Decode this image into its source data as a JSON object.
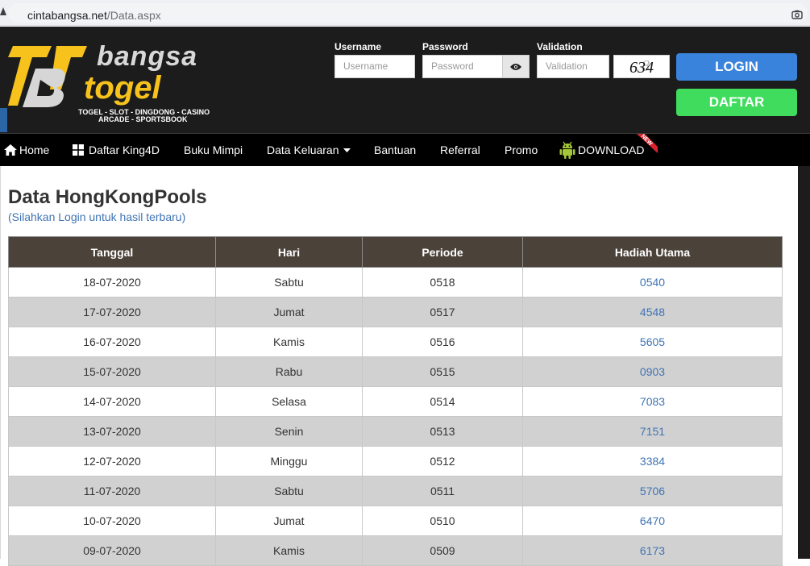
{
  "browser": {
    "url_domain": "cintabangsa.net",
    "url_path": "/Data.aspx"
  },
  "logo": {
    "word1": "bangsa",
    "word2": "togel",
    "tagline1": "TOGEL - SLOT - DINGDONG - CASINO",
    "tagline2": "ARCADE - SPORTSBOOK"
  },
  "login_form": {
    "username_label": "Username",
    "username_placeholder": "Username",
    "password_label": "Password",
    "password_placeholder": "Password",
    "validation_label": "Validation",
    "validation_placeholder": "Validation",
    "captcha_text": "634",
    "captcha_noise": "8",
    "login_button": "LOGIN",
    "daftar_button": "DAFTAR"
  },
  "nav": {
    "items": [
      {
        "label": "Home",
        "icon": "home-icon"
      },
      {
        "label": "Daftar King4D",
        "icon": "windows-icon"
      },
      {
        "label": "Buku Mimpi"
      },
      {
        "label": "Data Keluaran",
        "icon": "caret-down-icon"
      },
      {
        "label": "Bantuan"
      },
      {
        "label": "Referral"
      },
      {
        "label": "Promo"
      },
      {
        "label": "DOWNLOAD",
        "icon": "android-icon"
      }
    ],
    "new_badge": "NEW"
  },
  "page": {
    "title": "Data HongKongPools",
    "subtitle": "(Silahkan Login untuk hasil terbaru)"
  },
  "table": {
    "headers": [
      "Tanggal",
      "Hari",
      "Periode",
      "Hadiah Utama"
    ],
    "rows": [
      [
        "18-07-2020",
        "Sabtu",
        "0518",
        "0540"
      ],
      [
        "17-07-2020",
        "Jumat",
        "0517",
        "4548"
      ],
      [
        "16-07-2020",
        "Kamis",
        "0516",
        "5605"
      ],
      [
        "15-07-2020",
        "Rabu",
        "0515",
        "0903"
      ],
      [
        "14-07-2020",
        "Selasa",
        "0514",
        "7083"
      ],
      [
        "13-07-2020",
        "Senin",
        "0513",
        "7151"
      ],
      [
        "12-07-2020",
        "Minggu",
        "0512",
        "3384"
      ],
      [
        "11-07-2020",
        "Sabtu",
        "0511",
        "5706"
      ],
      [
        "10-07-2020",
        "Jumat",
        "0510",
        "6470"
      ],
      [
        "09-07-2020",
        "Kamis",
        "0509",
        "6173"
      ]
    ]
  },
  "colors": {
    "header_bg": "#1c1c1c",
    "login_button": "#3a83dc",
    "daftar_button": "#3fdc5d",
    "table_header": "#4b4239",
    "link_blue": "#3f74b4",
    "logo_yellow": "#f6c21b",
    "android_green": "#a4c639"
  }
}
